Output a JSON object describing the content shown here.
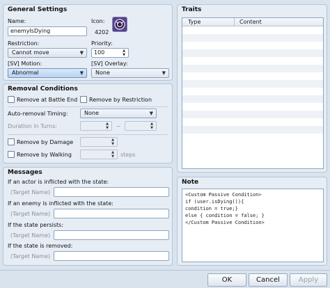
{
  "general": {
    "title": "General Settings",
    "name_label": "Name:",
    "name_value": "enemyIsDying",
    "icon_label": "Icon:",
    "icon_index": "4202",
    "restriction_label": "Restriction:",
    "restriction_value": "Cannot move",
    "priority_label": "Priority:",
    "priority_value": "100",
    "sv_motion_label": "[SV] Motion:",
    "sv_motion_value": "Abnormal",
    "sv_overlay_label": "[SV] Overlay:",
    "sv_overlay_value": "None"
  },
  "removal": {
    "title": "Removal Conditions",
    "remove_battle_end": "Remove at Battle End",
    "remove_restriction": "Remove by Restriction",
    "auto_timing_label": "Auto-removal Timing:",
    "auto_timing_value": "None",
    "duration_label": "Duration in Turns:",
    "duration_sep": "~",
    "remove_damage": "Remove by Damage",
    "remove_walking": "Remove by Walking",
    "steps_label": "steps"
  },
  "messages": {
    "title": "Messages",
    "actor_label": "If an actor is inflicted with the state:",
    "enemy_label": "If an enemy is inflicted with the state:",
    "persist_label": "If the state persists:",
    "removed_label": "If the state is removed:",
    "target_placeholder": "(Target Name)"
  },
  "traits": {
    "title": "Traits",
    "columns": [
      "Type",
      "Content"
    ],
    "rows": 14
  },
  "note": {
    "title": "Note",
    "text": "<Custom Passive Condition>\nif (user.isDying()){\ncondition = true;}\nelse { condition = false; }\n</Custom Passive Condition>"
  },
  "buttons": {
    "ok": "OK",
    "cancel": "Cancel",
    "apply": "Apply"
  },
  "colors": {
    "background": "#d9e3ee",
    "panel": "#e6edf5",
    "selected_combo": "#b9d3f2",
    "icon": "#5a3f8e"
  }
}
